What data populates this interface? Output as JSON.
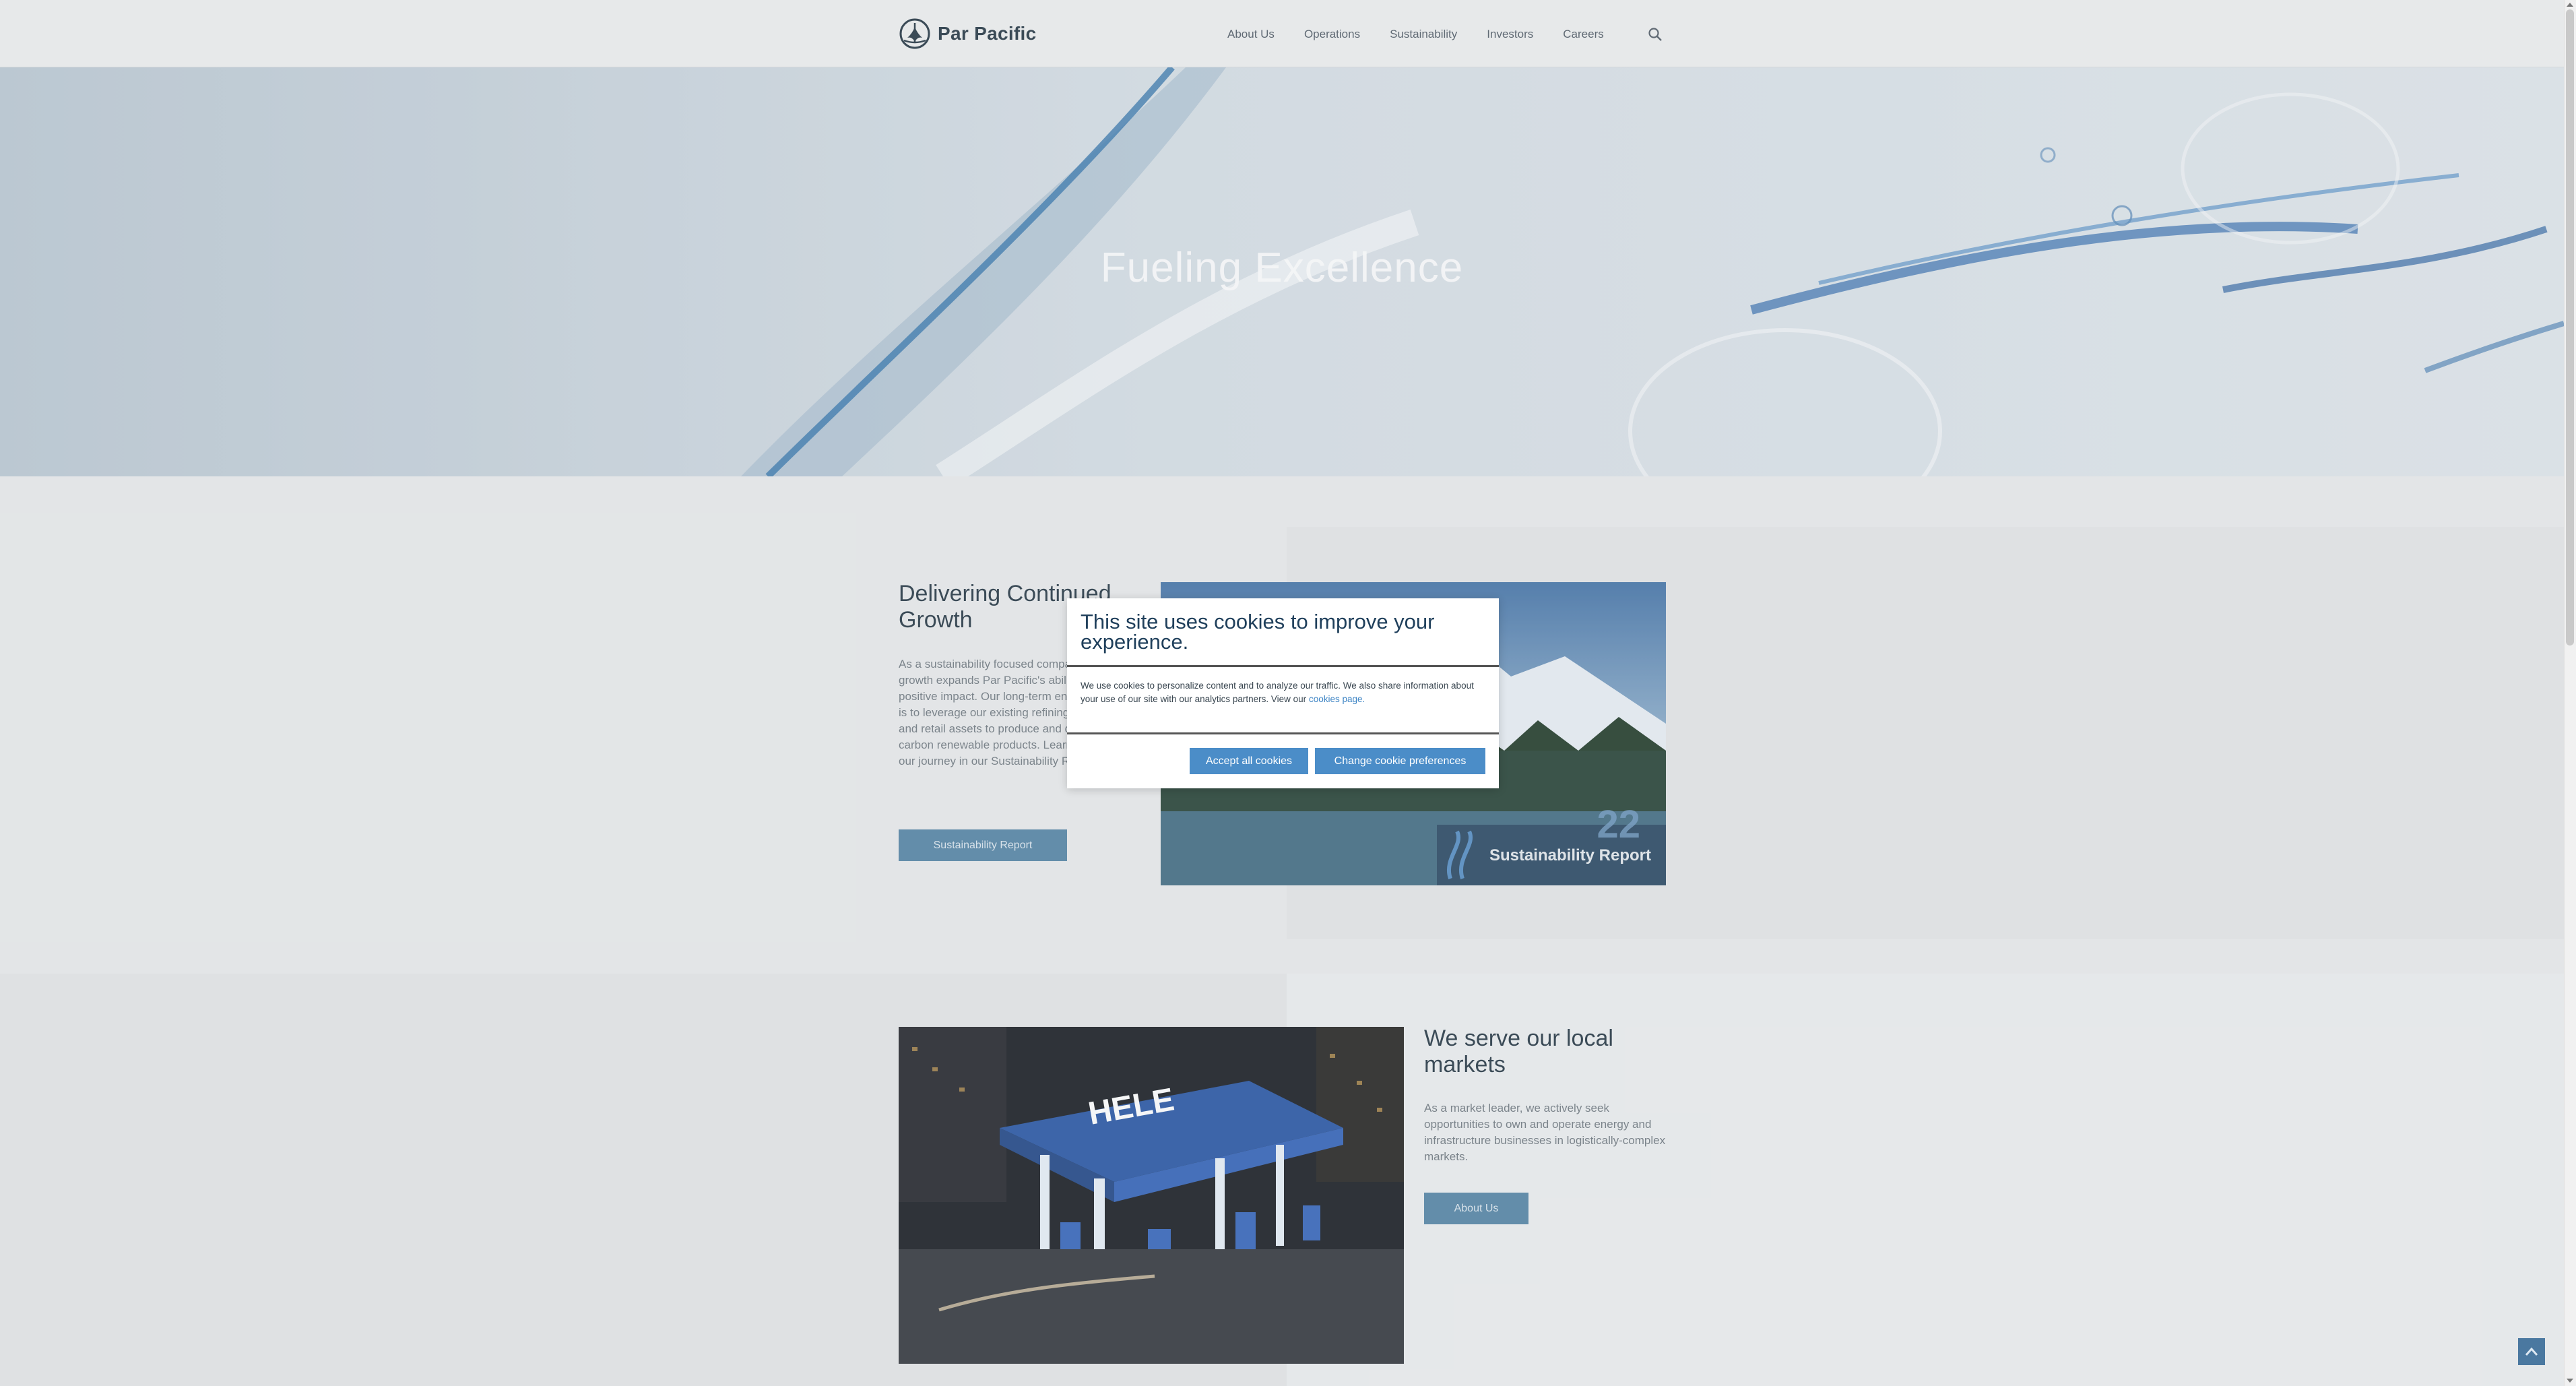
{
  "header": {
    "logo_text": "Par Pacific",
    "nav": [
      "About Us",
      "Operations",
      "Sustainability",
      "Investors",
      "Careers"
    ]
  },
  "hero": {
    "title": "Fueling Excellence"
  },
  "section1": {
    "title": "Delivering Continued Growth",
    "body": "As a sustainability focused company, our growth expands Par Pacific's ability to create positive impact. Our long-term energy strategy is to leverage our existing refining, logistics, and retail assets to produce and deliver lower carbon renewable products. Learn more about our journey in our Sustainability Report.",
    "button": "Sustainability Report",
    "report_year": "22",
    "report_label": "Sustainability Report"
  },
  "section2": {
    "title": "We serve our local markets",
    "body": "As a market leader, we actively seek opportunities to own and operate energy and infrastructure businesses in logistically-complex markets.",
    "button": "About Us",
    "station_sign": "HELE"
  },
  "cookie_modal": {
    "title": "This site uses cookies to improve your experience.",
    "text": "We use cookies to personalize content and to analyze our traffic. We also share information about your use of our site with our analytics partners. View our",
    "link": "cookies page",
    "link_suffix": ".",
    "accept": "Accept all cookies",
    "change": "Change cookie preferences"
  },
  "colors": {
    "brand": "#1d2f3c",
    "button": "#4d7fa1",
    "modal_button": "#4b8dc8"
  },
  "icons": {
    "search": "search-icon",
    "back_to_top": "chevron-up-icon"
  }
}
